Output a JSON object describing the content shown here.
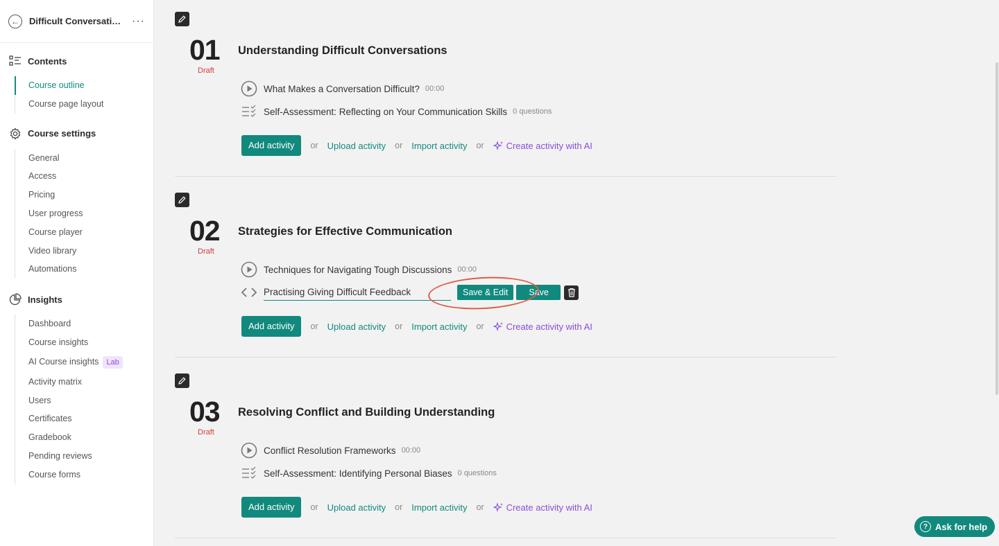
{
  "sidebar": {
    "course_title": "Difficult Conversati…",
    "more_label": "···",
    "contents": {
      "label": "Contents",
      "items": [
        "Course outline",
        "Course page layout"
      ]
    },
    "settings": {
      "label": "Course settings",
      "items": [
        "General",
        "Access",
        "Pricing",
        "User progress",
        "Course player",
        "Video library",
        "Automations"
      ]
    },
    "insights": {
      "label": "Insights",
      "items": [
        "Dashboard",
        "Course insights",
        "AI Course insights",
        "Activity matrix",
        "Users",
        "Certificates",
        "Gradebook",
        "Pending reviews",
        "Course forms"
      ],
      "lab_badge": "Lab"
    }
  },
  "sections": [
    {
      "number": "01",
      "status": "Draft",
      "title": "Understanding Difficult Conversations",
      "activities": [
        {
          "type": "video",
          "title": "What Makes a Conversation Difficult?",
          "meta": "00:00"
        },
        {
          "type": "quiz",
          "title": "Self-Assessment: Reflecting on Your Communication Skills",
          "meta": "0 questions"
        }
      ]
    },
    {
      "number": "02",
      "status": "Draft",
      "title": "Strategies for Effective Communication",
      "activities": [
        {
          "type": "video",
          "title": "Techniques for Navigating Tough Discussions",
          "meta": "00:00"
        }
      ],
      "editing": {
        "value": "Practising Giving Difficult Feedback",
        "save_edit_label": "Save & Edit",
        "save_label": "Save"
      }
    },
    {
      "number": "03",
      "status": "Draft",
      "title": "Resolving Conflict and Building Understanding",
      "activities": [
        {
          "type": "video",
          "title": "Conflict Resolution Frameworks",
          "meta": "00:00"
        },
        {
          "type": "quiz",
          "title": "Self-Assessment: Identifying Personal Biases",
          "meta": "0 questions"
        }
      ]
    }
  ],
  "actions": {
    "add_activity": "Add activity",
    "or": "or",
    "upload_activity": "Upload activity",
    "import_activity": "Import activity",
    "create_ai": "Create activity with AI"
  },
  "help": {
    "label": "Ask for help",
    "icon_text": "?"
  },
  "colors": {
    "accent": "#12897d",
    "draft": "#d23b3b",
    "ai": "#8a4fd6",
    "highlight": "#e25d45"
  }
}
